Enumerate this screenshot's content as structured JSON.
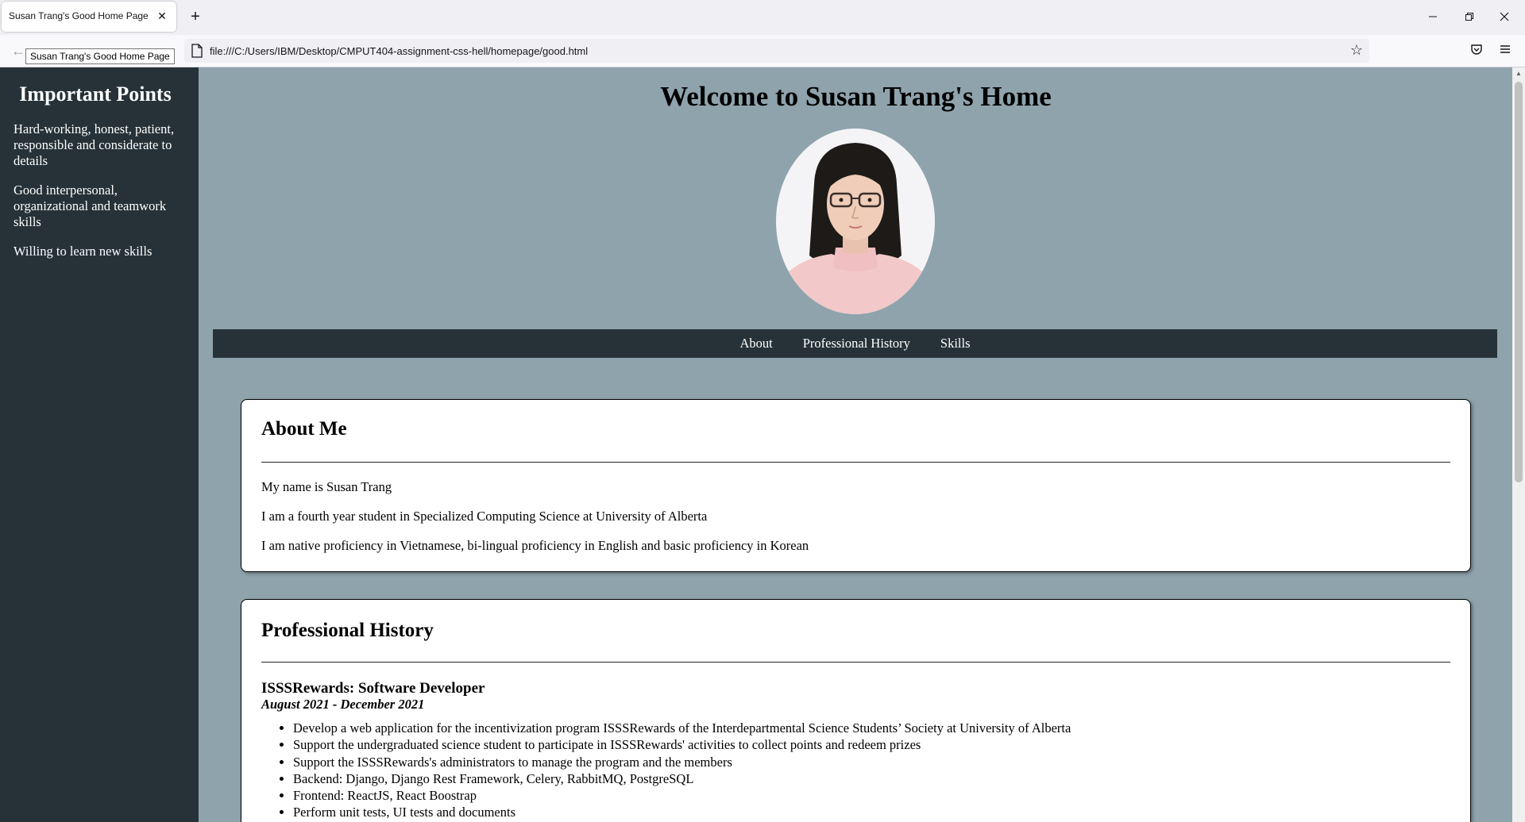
{
  "browser": {
    "tab_title": "Susan Trang's Good Home Page",
    "tab_close": "✕",
    "new_tab": "+",
    "tooltip": "Susan Trang's Good Home Page",
    "url": "file:///C:/Users/IBM/Desktop/CMPUT404-assignment-css-hell/homepage/good.html",
    "window_controls": {
      "minimize": "—",
      "restore": "❐",
      "close": "✕"
    }
  },
  "sidebar": {
    "title": "Important Points",
    "items": [
      {
        "text": "Hard-working, honest, patient, responsible and considerate to details"
      },
      {
        "text": "Good interpersonal, organizational and teamwork skills"
      },
      {
        "text": "Willing to learn new skills"
      }
    ]
  },
  "header": {
    "title": "Welcome to Susan Trang's Home"
  },
  "nav": {
    "links": [
      {
        "label": "About"
      },
      {
        "label": "Professional History"
      },
      {
        "label": "Skills"
      }
    ]
  },
  "about": {
    "heading": "About Me",
    "paragraphs": [
      "My name is Susan Trang",
      "I am a fourth year student in Specialized Computing Science at University of Alberta",
      "I am native proficiency in Vietnamese, bi-lingual proficiency in English and basic proficiency in Korean"
    ]
  },
  "history": {
    "heading": "Professional History",
    "jobs": [
      {
        "title": "ISSSRewards: Software Developer",
        "dates": "August 2021 - December 2021",
        "bullets": [
          "Develop a web application for the incentivization program ISSSRewards of the Interdepartmental Science Students’ Society at University of Alberta",
          "Support the undergraduated science student to participate in ISSSRewards' activities to collect points and redeem prizes",
          "Support the ISSSRewards's administrators to manage the program and the members",
          "Backend: Django, Django Rest Framework, Celery, RabbitMQ, PostgreSQL",
          "Frontend: ReactJS, React Boostrap",
          "Perform unit tests, UI tests and documents"
        ]
      }
    ]
  },
  "colors": {
    "page_background": "#8fa3ad",
    "sidebar_background": "#263238",
    "nav_background": "#263238",
    "card_background": "#ffffff"
  },
  "icons": [
    "back-arrow-icon",
    "page-icon",
    "bookmark-star-icon",
    "pocket-icon",
    "menu-icon",
    "avatar-photo"
  ]
}
